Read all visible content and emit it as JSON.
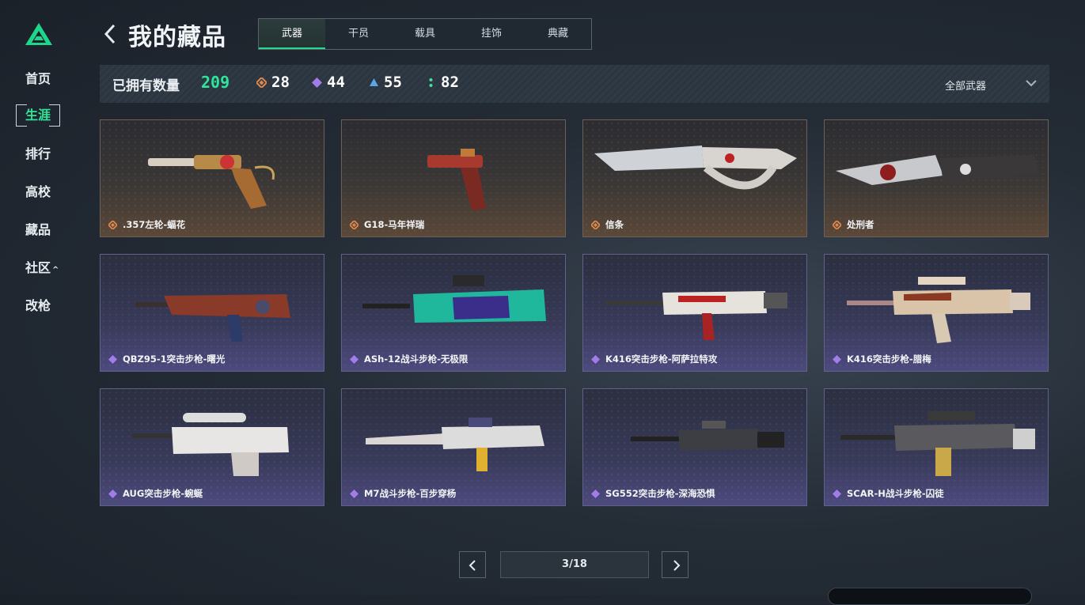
{
  "sidebar": {
    "items": [
      {
        "label": "首页"
      },
      {
        "label": "生涯"
      },
      {
        "label": "排行"
      },
      {
        "label": "高校"
      },
      {
        "label": "藏品"
      },
      {
        "label": "社区",
        "caret": "^"
      },
      {
        "label": "改枪"
      }
    ],
    "active_index": 1
  },
  "header": {
    "title": "我的藏品",
    "tabs": [
      {
        "label": "武器"
      },
      {
        "label": "干员"
      },
      {
        "label": "载具"
      },
      {
        "label": "挂饰"
      },
      {
        "label": "典藏"
      }
    ],
    "active_tab": 0
  },
  "stats": {
    "owned_label": "已拥有数量",
    "owned_count": "209",
    "tiers": [
      {
        "icon": "orange-diamond-icon",
        "color": "#e0874a",
        "count": "28"
      },
      {
        "icon": "purple-diamond-icon",
        "color": "#a27ce8",
        "count": "44"
      },
      {
        "icon": "blue-triangle-icon",
        "color": "#5ea5e6",
        "count": "55"
      },
      {
        "icon": "green-dots-icon",
        "color": "#3fe09c",
        "count": "82"
      }
    ],
    "filter_label": "全部武器"
  },
  "colors": {
    "accent": "#2fe59a",
    "orange_tier": "#e0874a",
    "purple_tier": "#a27ce8"
  },
  "cards": [
    {
      "name": ".357左轮-蝠花",
      "rarity": "orange",
      "weapon": "revolver"
    },
    {
      "name": "G18-马年祥瑞",
      "rarity": "orange",
      "weapon": "pistol"
    },
    {
      "name": "信条",
      "rarity": "orange",
      "weapon": "knife"
    },
    {
      "name": "处刑者",
      "rarity": "orange",
      "weapon": "knife2"
    },
    {
      "name": "QBZ95-1突击步枪-曙光",
      "rarity": "purple",
      "weapon": "bullpup"
    },
    {
      "name": "ASh-12战斗步枪-无极限",
      "rarity": "purple",
      "weapon": "ash12"
    },
    {
      "name": "K416突击步枪-阿萨拉特攻",
      "rarity": "purple",
      "weapon": "ar"
    },
    {
      "name": "K416突击步枪-腊梅",
      "rarity": "purple",
      "weapon": "ar2"
    },
    {
      "name": "AUG突击步枪-蜿蜒",
      "rarity": "purple",
      "weapon": "aug"
    },
    {
      "name": "M7战斗步枪-百步穿杨",
      "rarity": "purple",
      "weapon": "m7"
    },
    {
      "name": "SG552突击步枪-深海恐惧",
      "rarity": "purple",
      "weapon": "sg552"
    },
    {
      "name": "SCAR-H战斗步枪-囚徒",
      "rarity": "purple",
      "weapon": "scar"
    }
  ],
  "pagination": {
    "label": "3/18",
    "prev_icon": "chevron-left-icon",
    "next_icon": "chevron-right-icon"
  }
}
